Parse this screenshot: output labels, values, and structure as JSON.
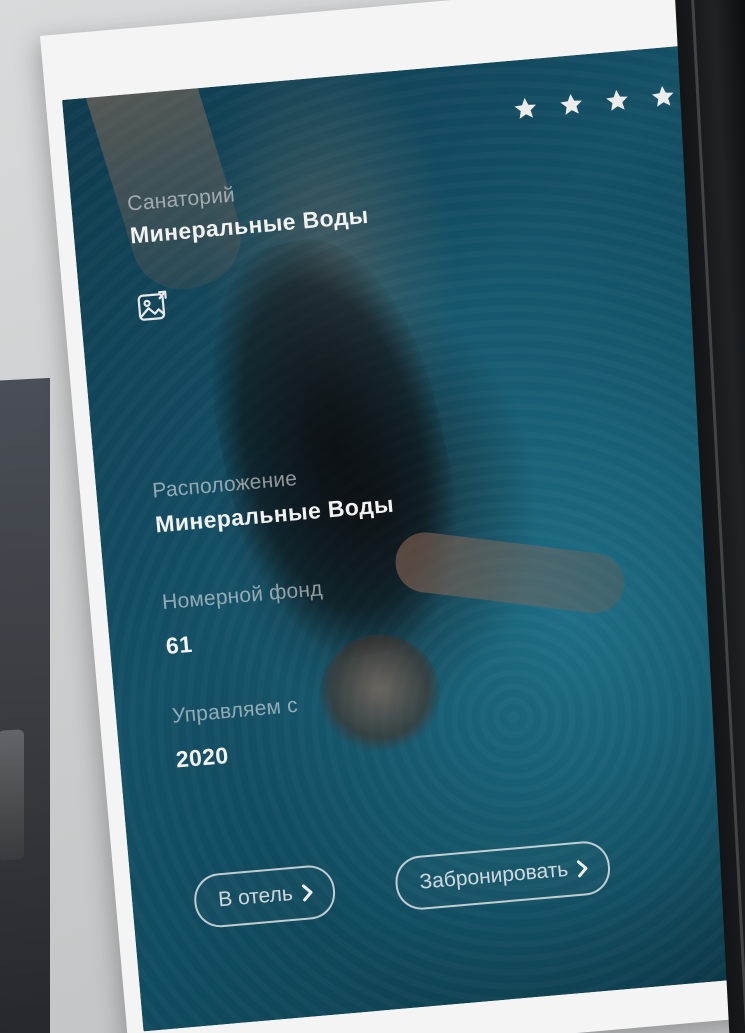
{
  "hotel": {
    "stars": 4,
    "type_label": "Санаторий",
    "name": "Минеральные Воды"
  },
  "details": {
    "location_label": "Расположение",
    "location_value": "Минеральные Воды",
    "rooms_label": "Номерной фонд",
    "rooms_value": "61",
    "managed_label": "Управляем с",
    "managed_value": "2020"
  },
  "actions": {
    "to_hotel": "В отель",
    "book": "Забронировать"
  },
  "icons": {
    "stars": "star-icon",
    "gallery": "image-gallery-icon",
    "chevron": "chevron-right-icon"
  },
  "colors": {
    "panel_bg": "#145066",
    "text": "#f2f2f2"
  }
}
